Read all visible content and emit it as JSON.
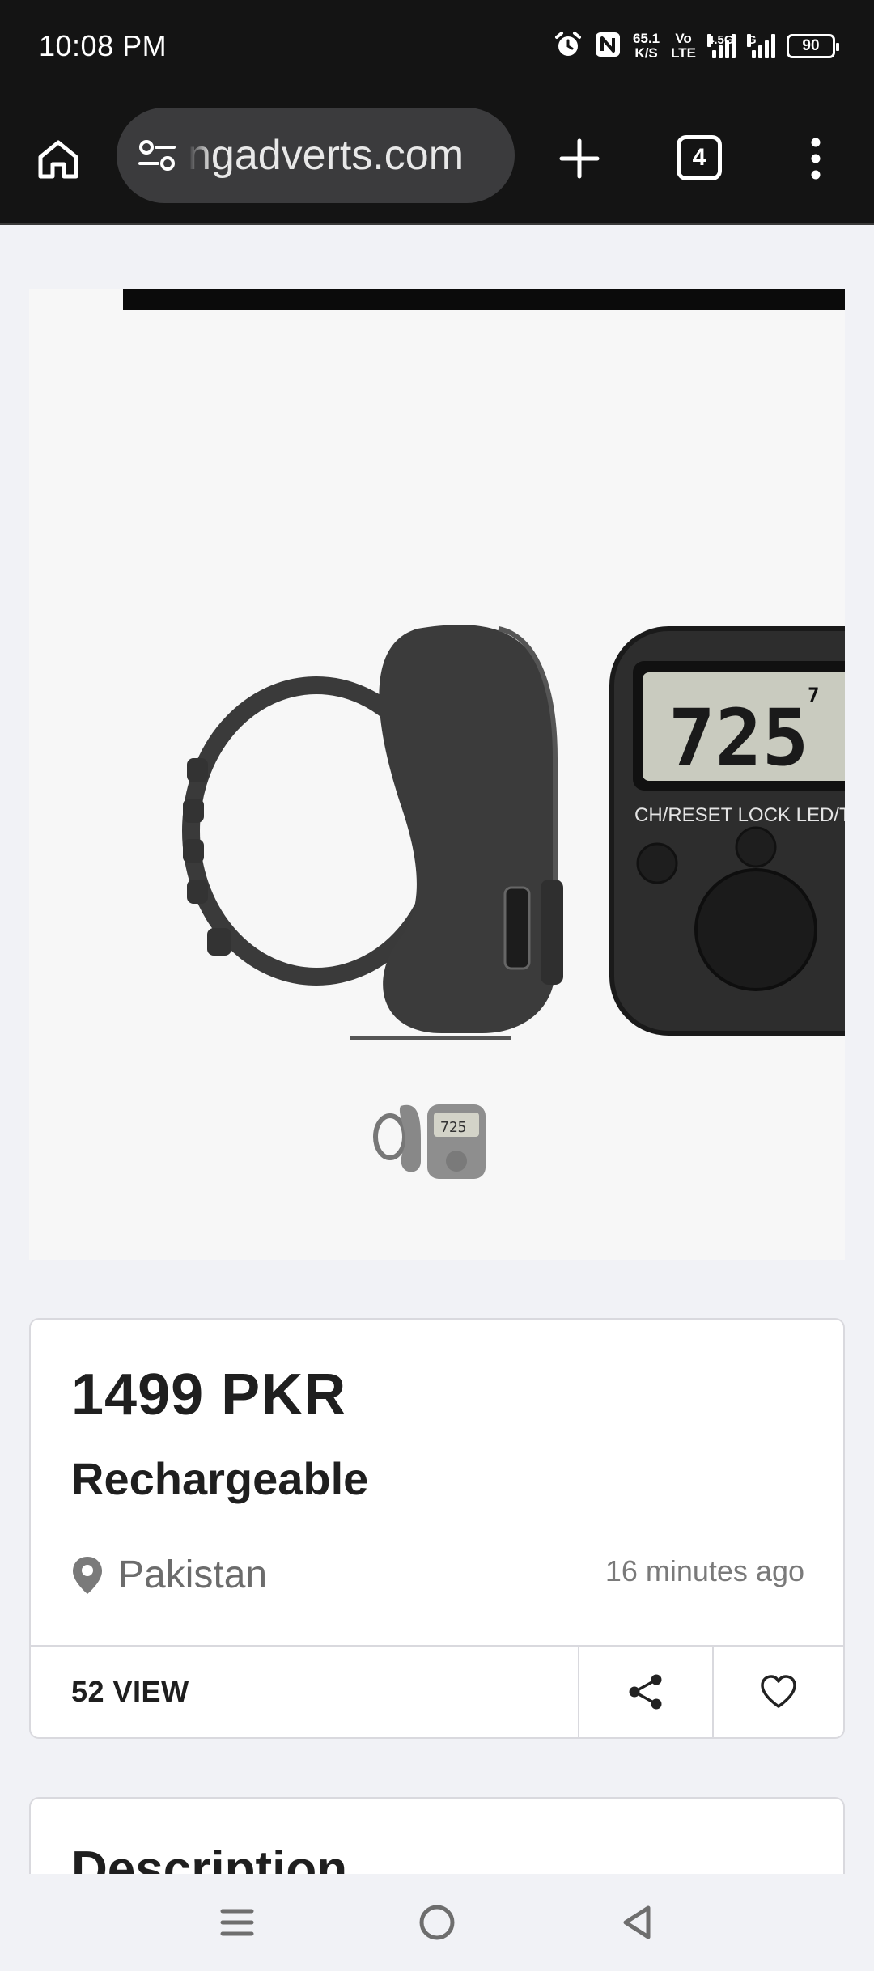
{
  "status_bar": {
    "time": "10:08 PM",
    "speed_value": "65.1",
    "speed_unit": "K/S",
    "volte_top": "Vo",
    "volte_bottom": "LTE",
    "network_type": "4.5G",
    "network_type_2": "G",
    "battery": "90",
    "icons": [
      "alarm-icon",
      "nfc-icon",
      "signal-icon",
      "battery-icon"
    ]
  },
  "browser": {
    "url": "ngadverts.com",
    "tab_count": "4",
    "icons": [
      "home-icon",
      "site-settings-icon",
      "new-tab-icon",
      "tab-switcher-icon",
      "more-menu-icon"
    ]
  },
  "product_image": {
    "counter_lcd_value": "725",
    "counter_lcd_top": "7",
    "counter_buttons_text": "CH/RESET  LOCK  LED/T",
    "thumbnail_text": "725"
  },
  "listing": {
    "price": "1499 PKR",
    "title": "Rechargeable",
    "location": "Pakistan",
    "posted": "16 minutes ago",
    "views": "52 VIEW"
  },
  "description": {
    "heading": "Description"
  },
  "colors": {
    "status_bg": "#141414",
    "page_bg": "#f1f2f6",
    "url_pill": "#3b3b3d",
    "card_border": "#d9d9de"
  }
}
